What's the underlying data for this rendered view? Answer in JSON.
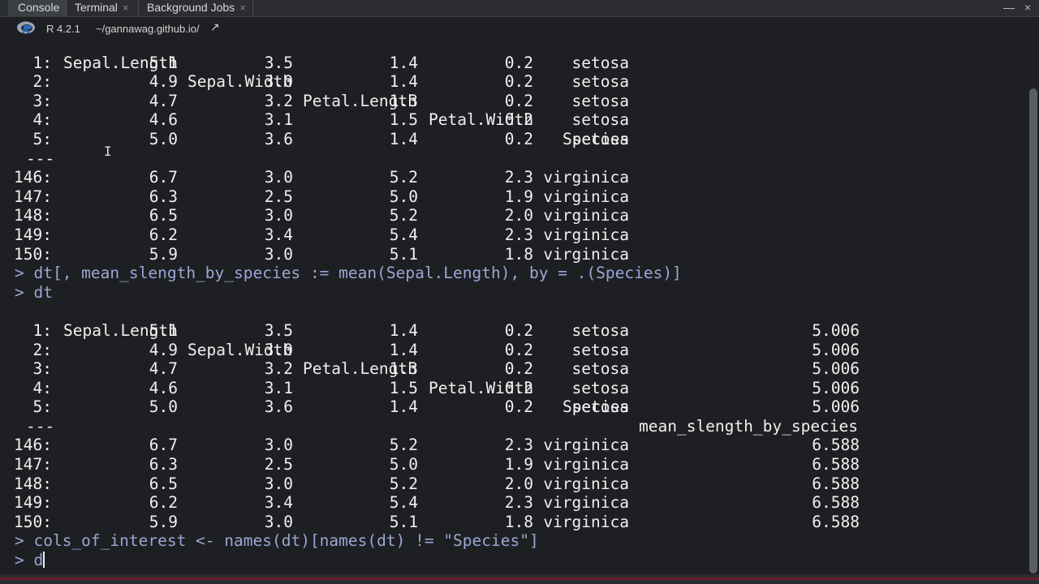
{
  "tabs": [
    {
      "label": "Console",
      "closable": false,
      "active": true
    },
    {
      "label": "Terminal",
      "closable": true
    },
    {
      "label": "Background Jobs",
      "closable": true
    }
  ],
  "window_controls": {
    "minimize": "—",
    "close": "×"
  },
  "pathbar": {
    "r_version": "R 4.2.1",
    "working_dir": "~/gannawag.github.io/",
    "go_icon": "↗"
  },
  "table1": {
    "header": [
      "Sepal.Length",
      "Sepal.Width",
      "Petal.Length",
      "Petal.Width",
      "Species"
    ],
    "rows": [
      [
        "1:",
        "5.1",
        "3.5",
        "1.4",
        "0.2",
        "setosa"
      ],
      [
        "2:",
        "4.9",
        "3.0",
        "1.4",
        "0.2",
        "setosa"
      ],
      [
        "3:",
        "4.7",
        "3.2",
        "1.3",
        "0.2",
        "setosa"
      ],
      [
        "4:",
        "4.6",
        "3.1",
        "1.5",
        "0.2",
        "setosa"
      ],
      [
        "5:",
        "5.0",
        "3.6",
        "1.4",
        "0.2",
        "setosa"
      ],
      [
        "---"
      ],
      [
        "146:",
        "6.7",
        "3.0",
        "5.2",
        "2.3",
        "virginica"
      ],
      [
        "147:",
        "6.3",
        "2.5",
        "5.0",
        "1.9",
        "virginica"
      ],
      [
        "148:",
        "6.5",
        "3.0",
        "5.2",
        "2.0",
        "virginica"
      ],
      [
        "149:",
        "6.2",
        "3.4",
        "5.4",
        "2.3",
        "virginica"
      ],
      [
        "150:",
        "5.9",
        "3.0",
        "5.1",
        "1.8",
        "virginica"
      ]
    ]
  },
  "commands": [
    "> dt[, mean_slength_by_species := mean(Sepal.Length), by = .(Species)]",
    "> dt"
  ],
  "table2": {
    "header": [
      "Sepal.Length",
      "Sepal.Width",
      "Petal.Length",
      "Petal.Width",
      "Species",
      "mean_slength_by_species"
    ],
    "rows": [
      [
        "1:",
        "5.1",
        "3.5",
        "1.4",
        "0.2",
        "setosa",
        "5.006"
      ],
      [
        "2:",
        "4.9",
        "3.0",
        "1.4",
        "0.2",
        "setosa",
        "5.006"
      ],
      [
        "3:",
        "4.7",
        "3.2",
        "1.3",
        "0.2",
        "setosa",
        "5.006"
      ],
      [
        "4:",
        "4.6",
        "3.1",
        "1.5",
        "0.2",
        "setosa",
        "5.006"
      ],
      [
        "5:",
        "5.0",
        "3.6",
        "1.4",
        "0.2",
        "setosa",
        "5.006"
      ],
      [
        "---"
      ],
      [
        "146:",
        "6.7",
        "3.0",
        "5.2",
        "2.3",
        "virginica",
        "6.588"
      ],
      [
        "147:",
        "6.3",
        "2.5",
        "5.0",
        "1.9",
        "virginica",
        "6.588"
      ],
      [
        "148:",
        "6.5",
        "3.0",
        "5.2",
        "2.0",
        "virginica",
        "6.588"
      ],
      [
        "149:",
        "6.2",
        "3.4",
        "5.4",
        "2.3",
        "virginica",
        "6.588"
      ],
      [
        "150:",
        "5.9",
        "3.0",
        "5.1",
        "1.8",
        "virginica",
        "6.588"
      ]
    ]
  },
  "commands_after": [
    "> cols_of_interest <- names(dt)[names(dt) != \"Species\"]"
  ],
  "current_input": "> d",
  "colors": {
    "background": "#1e1f22",
    "text": "#f0f0f0",
    "command": "#9aa6d6",
    "accent": "#6a1f2a"
  },
  "icons": {
    "r_logo": "r-logo-icon",
    "arrow": "go-to-directory-icon"
  }
}
